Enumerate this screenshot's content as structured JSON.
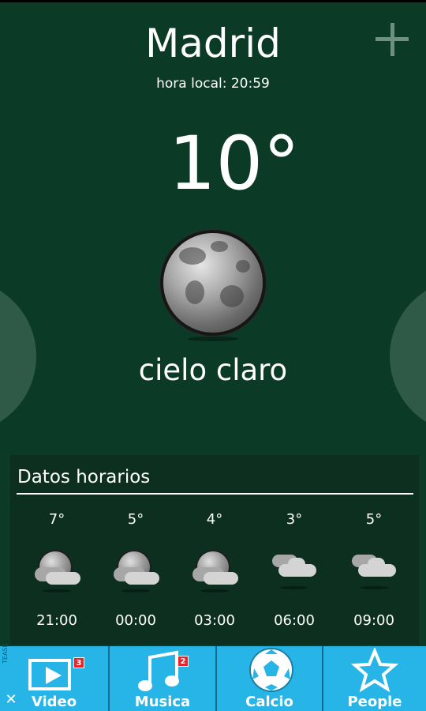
{
  "header": {
    "city": "Madrid",
    "local_time": "hora local: 20:59",
    "add_icon": "plus-icon"
  },
  "current": {
    "temperature": "10°",
    "condition": "cielo claro",
    "icon": "moon-icon"
  },
  "hourly": {
    "title": "Datos horarios",
    "items": [
      {
        "temp": "7°",
        "time": "21:00",
        "icon": "moon-cloud-icon"
      },
      {
        "temp": "5°",
        "time": "00:00",
        "icon": "moon-cloud-icon"
      },
      {
        "temp": "4°",
        "time": "03:00",
        "icon": "moon-cloud-icon"
      },
      {
        "temp": "3°",
        "time": "06:00",
        "icon": "cloud-icon"
      },
      {
        "temp": "5°",
        "time": "09:00",
        "icon": "cloud-icon"
      }
    ]
  },
  "ad": {
    "brand": "TEASE",
    "close_label": "✕",
    "tiles": [
      {
        "label": "Video",
        "badge": "3",
        "icon": "play-icon"
      },
      {
        "label": "Musica",
        "badge": "2",
        "icon": "music-note-icon"
      },
      {
        "label": "Calcio",
        "icon": "soccer-ball-icon"
      },
      {
        "label": "People",
        "icon": "star-icon"
      }
    ]
  },
  "colors": {
    "background": "#0b3a26",
    "panel": "#0c2f20",
    "ad_blue": "#27b5e8",
    "badge_red": "#e5252b"
  }
}
